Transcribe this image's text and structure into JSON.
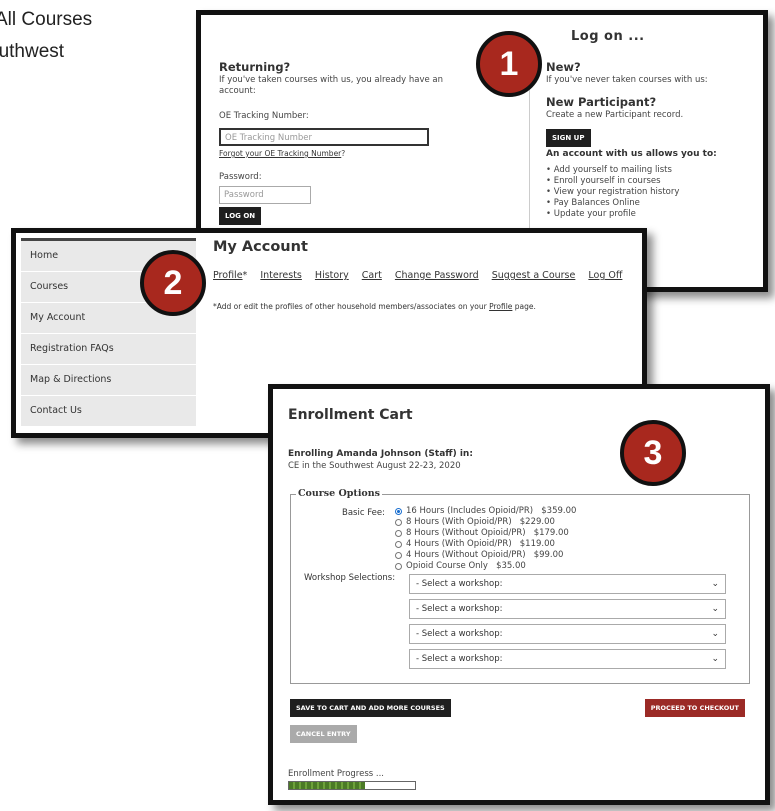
{
  "background_text": {
    "line1": "ct All Courses",
    "line2": "outhwest"
  },
  "badges": [
    "1",
    "2",
    "3"
  ],
  "logon": {
    "title": "Log on ...",
    "returning": {
      "heading": "Returning?",
      "desc": "If you've taken courses with us, you already have an account:",
      "tracking_label": "OE Tracking Number:",
      "tracking_placeholder": "OE Tracking Number",
      "forgot_link": "Forgot your OE Tracking Number",
      "forgot_suffix": "?",
      "password_label": "Password:",
      "password_placeholder": "Password",
      "button": "LOG ON"
    },
    "new": {
      "heading": "New?",
      "desc": "If you've never taken courses with us:",
      "participant_heading": "New Participant?",
      "participant_desc": "Create a new Participant record.",
      "button": "SIGN UP",
      "benefits_heading": "An account with us allows you to:",
      "benefits": [
        "Add yourself to mailing lists",
        "Enroll yourself in courses",
        "View your registration history",
        "Pay Balances Online",
        "Update your profile"
      ]
    }
  },
  "account": {
    "sidebar": [
      "Home",
      "Courses",
      "My Account",
      "Registration FAQs",
      "Map & Directions",
      "Contact Us"
    ],
    "title": "My Account",
    "nav": {
      "profile": "Profile",
      "profile_mark": "*",
      "interests": "Interests",
      "history": "History",
      "cart": "Cart",
      "change_password": "Change Password",
      "suggest": "Suggest a Course",
      "logoff": "Log Off"
    },
    "note_before": "*Add or edit the profiles of other household members/associates on your ",
    "note_link": "Profile",
    "note_after": " page."
  },
  "cart": {
    "title": "Enrollment Cart",
    "enrolling": "Enrolling Amanda Johnson (Staff) in:",
    "session": "CE in the Southwest August 22-23, 2020",
    "legend": "Course Options",
    "fee_label": "Basic Fee:",
    "fees": [
      {
        "label": "16 Hours (Includes Opioid/PR)",
        "price": "$359.00",
        "selected": true
      },
      {
        "label": "8 Hours (With Opioid/PR)",
        "price": "$229.00",
        "selected": false
      },
      {
        "label": "8 Hours (Without Opioid/PR)",
        "price": "$179.00",
        "selected": false
      },
      {
        "label": "4 Hours (With Opioid/PR)",
        "price": "$119.00",
        "selected": false
      },
      {
        "label": "4 Hours (Without Opioid/PR)",
        "price": "$99.00",
        "selected": false
      },
      {
        "label": "Opioid Course Only",
        "price": "$35.00",
        "selected": false
      }
    ],
    "workshop_label": "Workshop Selections:",
    "workshops": [
      "- Select a workshop:",
      "- Select a workshop:",
      "- Select a workshop:",
      "- Select a workshop:"
    ],
    "save_button": "SAVE TO CART AND ADD MORE COURSES",
    "checkout_button": "PROCEED TO CHECKOUT",
    "cancel_button": "CANCEL ENTRY",
    "progress_label": "Enrollment Progress ...",
    "progress_fraction": 0.6
  }
}
